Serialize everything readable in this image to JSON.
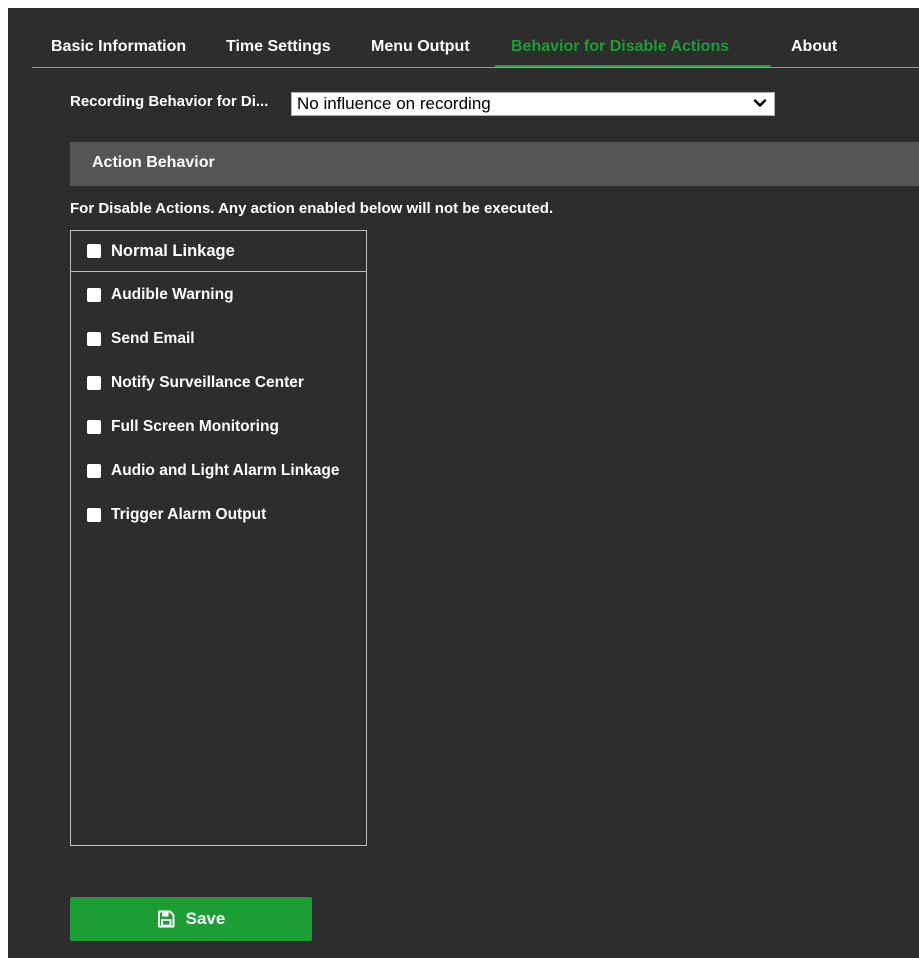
{
  "tabs": [
    {
      "label": "Basic Information",
      "active": false
    },
    {
      "label": "Time Settings",
      "active": false
    },
    {
      "label": "Menu Output",
      "active": false
    },
    {
      "label": "Behavior for Disable Actions",
      "active": true
    },
    {
      "label": "About",
      "active": false
    }
  ],
  "recording": {
    "label": "Recording Behavior for Di...",
    "selected": "No influence on recording"
  },
  "section": {
    "title": "Action Behavior",
    "note": "For Disable Actions. Any action enabled below will not be executed."
  },
  "linkage": {
    "header": {
      "label": "Normal Linkage",
      "checked": false
    },
    "items": [
      {
        "label": "Audible Warning",
        "checked": false
      },
      {
        "label": "Send Email",
        "checked": false
      },
      {
        "label": "Notify Surveillance Center",
        "checked": false
      },
      {
        "label": "Full Screen Monitoring",
        "checked": false
      },
      {
        "label": "Audio and Light Alarm Linkage",
        "checked": false
      },
      {
        "label": "Trigger Alarm Output",
        "checked": false
      }
    ]
  },
  "actions": {
    "save_label": "Save",
    "save_icon": "floppy-disk-icon"
  },
  "colors": {
    "background": "#2d2d2d",
    "accent": "#1c9d35",
    "section_bar": "#555555"
  }
}
